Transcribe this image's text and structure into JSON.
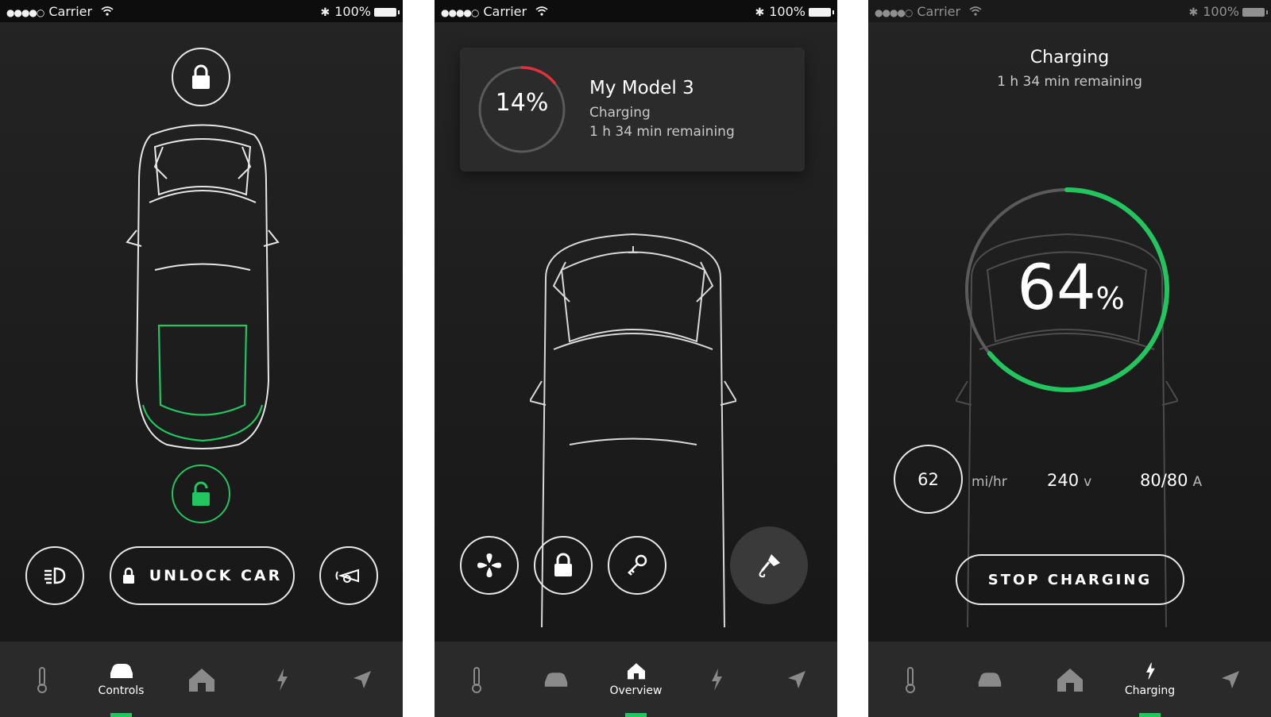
{
  "status_bar": {
    "carrier": "Carrier",
    "battery": "100%"
  },
  "controls_screen": {
    "unlock_button_label": "UNLOCK CAR",
    "tabs": [
      "Controls"
    ]
  },
  "overview_screen": {
    "card": {
      "percent": "14%",
      "percent_value": 14,
      "name": "My Model 3",
      "status": "Charging",
      "remaining": "1 h 34 min remaining"
    },
    "tabs": [
      "Overview"
    ]
  },
  "charging_screen": {
    "title": "Charging",
    "remaining": "1 h 34 min remaining",
    "percent_number": "64",
    "percent_unit": "%",
    "percent_value": 64,
    "speed_value": "62",
    "speed_unit": "mi/hr",
    "voltage_value": "240",
    "voltage_unit": "v",
    "current_value": "80/80",
    "current_unit": "A",
    "stop_button_label": "STOP CHARGING",
    "tabs": [
      "Charging"
    ]
  },
  "colors": {
    "accent_green": "#22c55e",
    "charge_red": "#e0323c",
    "background": "#1e1e1e"
  },
  "icons": [
    "thermometer-icon",
    "car-icon",
    "home-icon",
    "bolt-icon",
    "navigation-arrow-icon",
    "lock-icon",
    "unlock-icon",
    "headlights-icon",
    "horn-icon",
    "fan-icon",
    "key-icon",
    "microphone-icon"
  ]
}
